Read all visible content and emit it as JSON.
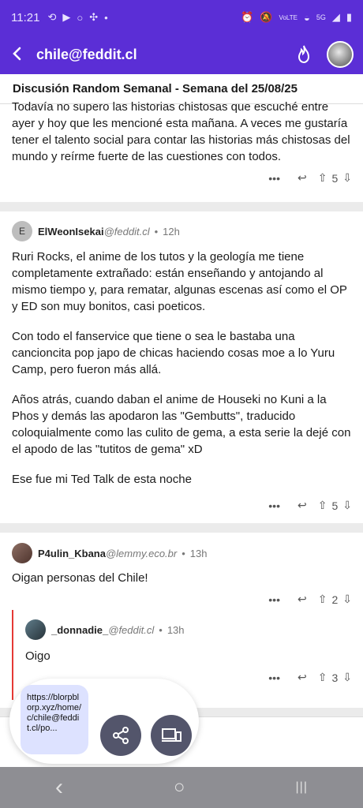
{
  "status": {
    "time": "11:21",
    "left_icons": [
      "sync-icon",
      "youtube-icon",
      "circle-icon",
      "fan-icon",
      "dot-icon"
    ],
    "right_icons": [
      "alarm-icon",
      "mute-icon",
      "volte-icon",
      "wifi-icon",
      "5g-icon",
      "signal-icon",
      "battery-icon"
    ],
    "volte": "VoLTE",
    "net": "5G"
  },
  "appbar": {
    "title": "chile@feddit.cl"
  },
  "post": {
    "title": "Discusión Random Semanal - Semana del 25/08/25"
  },
  "comments": [
    {
      "text": "Todavía no supero las historias chistosas que escuché entre ayer y hoy que les mencioné esta mañana. A veces me gustaría tener el talento social para contar las historias más chistosas del mundo y reírme fuerte de las cuestiones con todos.",
      "score": "5"
    },
    {
      "user": "ElWeonIsekai",
      "instance": "@feddit.cl",
      "time": "12h",
      "avatar_letter": "E",
      "paragraphs": [
        "Ruri Rocks, el anime de los tutos y la geología me tiene completamente extrañado: están enseñando y antojando al mismo tiempo y, para rematar, algunas escenas así como el OP y ED son muy bonitos, casi poeticos.",
        "Con todo el fanservice que tiene o sea le bastaba una cancioncita pop japo de chicas haciendo cosas moe a lo Yuru Camp, pero fueron más allá.",
        "Años atrás, cuando daban el anime de Houseki no Kuni a la Phos y demás las apodaron las \"Gembutts\", traducido coloquialmente como las culito de gema, a esta serie la dejé con el apodo de las \"tutitos de gema\" xD",
        "Ese fue mi Ted Talk de esta noche"
      ],
      "score": "5"
    },
    {
      "user": "P4ulin_Kbana",
      "instance": "@lemmy.eco.br",
      "time": "13h",
      "text": "Oigan personas del Chile!",
      "score": "2"
    },
    {
      "user": "_donnadie_",
      "instance": "@feddit.cl",
      "time": "13h",
      "text": "Oigo",
      "score": "3"
    }
  ],
  "actions": {
    "more": "•••",
    "reply": "↩",
    "upvote": "⇧",
    "downvote": "⇩"
  },
  "share": {
    "url": "https://blorpblorp.xyz/home/c/chile@feddit.cl/po..."
  },
  "nav": {
    "back": "‹",
    "home": "○",
    "recents": "|||"
  },
  "colors": {
    "accent": "#5b2ed6",
    "reply_bar": "#e53935"
  }
}
